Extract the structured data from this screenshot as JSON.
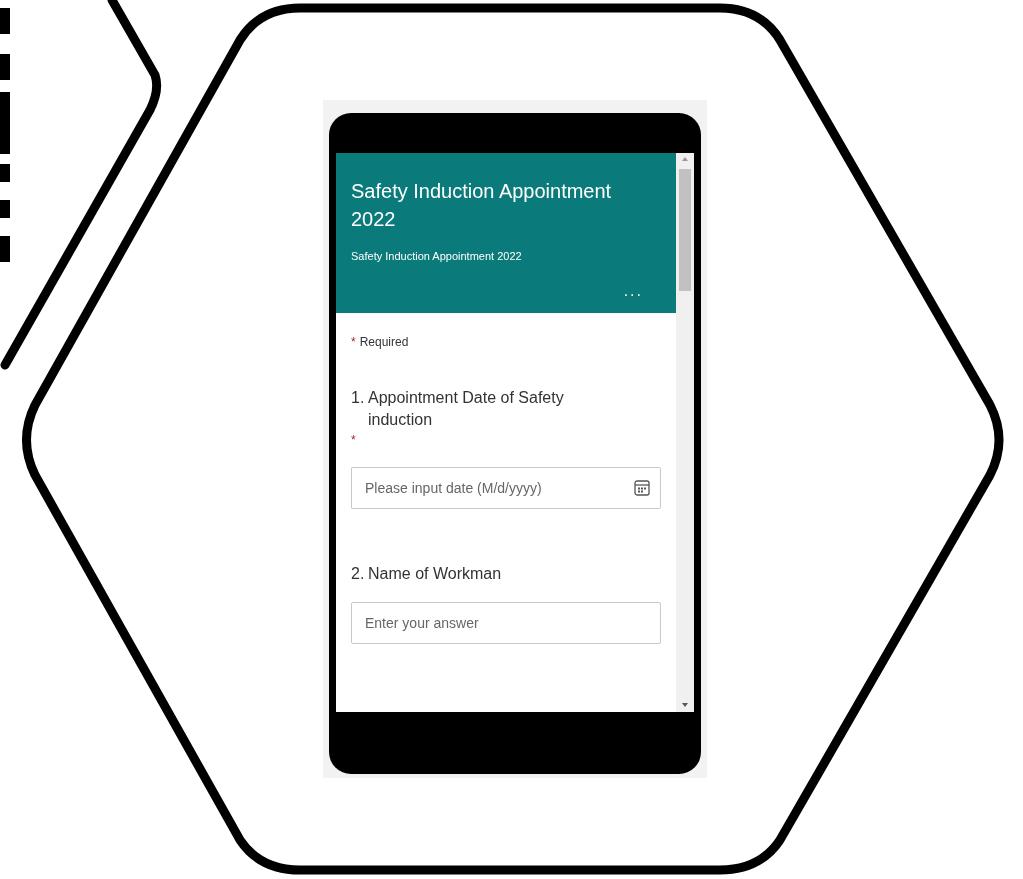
{
  "form": {
    "title": "Safety Induction Appointment 2022",
    "subtitle": "Safety Induction Appointment 2022",
    "more": "...",
    "required_note": "Required",
    "required_mark": "*",
    "questions": [
      {
        "number": "1.",
        "label": "Appointment Date of Safety induction",
        "required": true,
        "kind": "date",
        "placeholder": "Please input date (M/d/yyyy)"
      },
      {
        "number": "2.",
        "label": "Name of Workman",
        "required": false,
        "kind": "text",
        "placeholder": "Enter your answer"
      }
    ]
  }
}
